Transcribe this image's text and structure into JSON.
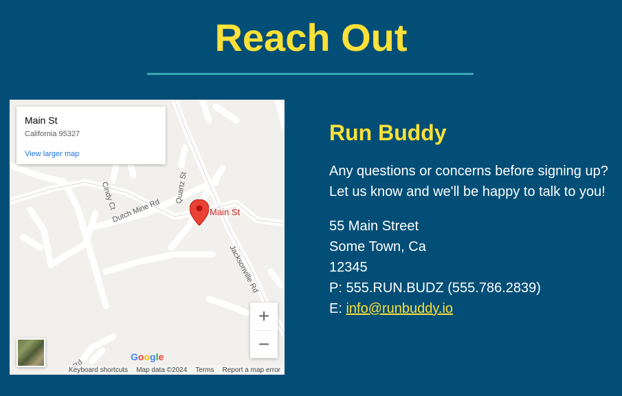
{
  "page": {
    "title": "Reach Out"
  },
  "map": {
    "info_card": {
      "title": "Main St",
      "address": "California 95327",
      "link": "View larger map"
    },
    "marker_label": "Main St",
    "roads": {
      "cindy": "Cindy Ct",
      "dutch": "Dutch Mine Rd",
      "quartz": "Quartz St",
      "jackson": "Jacksonville Rd",
      "lower": "Rd"
    },
    "zoom_in": "+",
    "zoom_out": "−",
    "logo": "Google",
    "attribution": {
      "shortcuts": "Keyboard shortcuts",
      "data": "Map data ©2024",
      "terms": "Terms",
      "report": "Report a map error"
    }
  },
  "contact": {
    "name": "Run Buddy",
    "message_line1": "Any questions or concerns before signing up?",
    "message_line2": "Let us know and we'll be happy to talk to you!",
    "street": "55 Main Street",
    "city": "Some Town, Ca",
    "zip": "12345",
    "phone": "P: 555.RUN.BUDZ (555.786.2839)",
    "email_prefix": "E: ",
    "email": "info@runbuddy.io"
  },
  "colors": {
    "background": "#024e76",
    "accent": "#fce138",
    "rule": "#39a6b2"
  }
}
